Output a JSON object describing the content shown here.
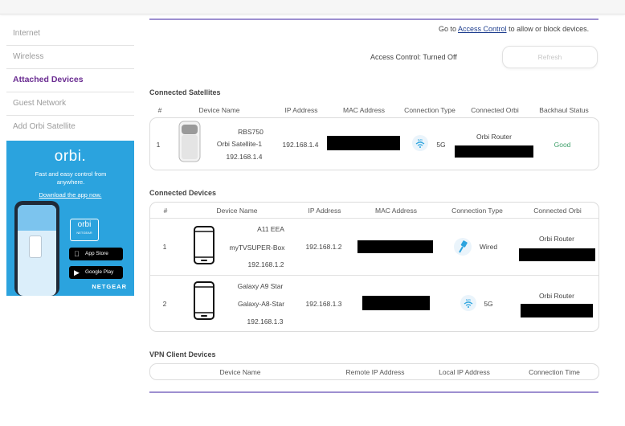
{
  "sidebar": {
    "items": [
      {
        "label": "Internet"
      },
      {
        "label": "Wireless"
      },
      {
        "label": "Attached Devices",
        "active": true
      },
      {
        "label": "Guest Network"
      },
      {
        "label": "Add Orbi Satellite"
      }
    ]
  },
  "promo": {
    "logo": "orbi.",
    "tagline": "Fast and easy control from anywhere.",
    "link": "Download the app now.",
    "mini_logo": "orbi",
    "mini_sub": "NETGEAR",
    "app_store": "App Store",
    "google_play": "Google Play",
    "brand": "NETGEAR",
    "bg_color": "#2ba3de"
  },
  "access": {
    "prefix": "Go to",
    "link": "Access Control",
    "suffix": "to allow or block devices.",
    "status": "Access Control: Turned Off",
    "refresh": "Refresh"
  },
  "satellites": {
    "title": "Connected Satellites",
    "headers": [
      "#",
      "Device Name",
      "IP Address",
      "MAC Address",
      "Connection Type",
      "Connected Orbi",
      "Backhaul Status"
    ],
    "rows": [
      {
        "num": "1",
        "model": "RBS750",
        "name": "Orbi Satellite-1",
        "ip_sub": "192.168.1.4",
        "ip": "192.168.1.4",
        "conn_badge": "5G",
        "conn": "5G",
        "orbi": "Orbi Router",
        "backhaul": "Good",
        "backhaul_color": "#3fa06b"
      }
    ]
  },
  "devices": {
    "title": "Connected Devices",
    "headers": [
      "#",
      "Device Name",
      "IP Address",
      "MAC Address",
      "Connection Type",
      "Connected Orbi"
    ],
    "rows": [
      {
        "num": "1",
        "model": "A11 EEA",
        "name": "myTVSUPER-Box",
        "ip_sub": "192.168.1.2",
        "ip": "192.168.1.2",
        "icon": "phone-icon",
        "conn_icon": "ethernet-icon",
        "conn": "Wired",
        "orbi": "Orbi Router"
      },
      {
        "num": "2",
        "model": "Galaxy A9 Star",
        "name": "Galaxy-A8-Star",
        "ip_sub": "192.168.1.3",
        "ip": "192.168.1.3",
        "icon": "phone-icon",
        "conn_badge": "5G",
        "conn": "5G",
        "orbi": "Orbi Router"
      }
    ]
  },
  "vpn": {
    "title": "VPN Client Devices",
    "headers": [
      "Device Name",
      "Remote IP Address",
      "Local IP Address",
      "Connection Time"
    ]
  },
  "colors": {
    "accent_purple": "#6a2c91",
    "divider_purple": "#9d8fd0",
    "link_blue": "#1f3f8f",
    "wifi_blue": "#2ba3de"
  }
}
